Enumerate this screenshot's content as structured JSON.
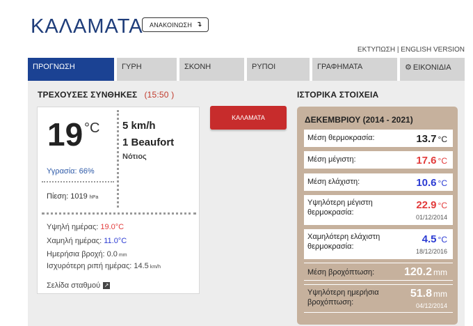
{
  "header": {
    "city": "ΚΑΛΑΜΑΤΑ",
    "announce_label": "ΑΝΑΚΟΙΝΩΣΗ",
    "announce_icon": "arrow-down-icon"
  },
  "links": {
    "print": "ΕΚΤΥΠΩΣΗ",
    "separator": "|",
    "english": "ENGLISH VERSION"
  },
  "tabs": [
    {
      "label": "ΠΡΟΓΝΩΣΗ",
      "active": true
    },
    {
      "label": "ΓΥΡΗ",
      "active": false
    },
    {
      "label": "ΣΚΟΝΗ",
      "active": false
    },
    {
      "label": "ΡΥΠΟΙ",
      "active": false
    },
    {
      "label": "ΓΡΑΦΗΜΑΤΑ",
      "active": false
    },
    {
      "label": "ΕΙΚΟΝΙΔΙΑ",
      "active": false,
      "icon": "gear-icon"
    }
  ],
  "current": {
    "heading": "ΤΡΕΧΟΥΣΕΣ ΣΥΝΘΗΚΕΣ",
    "time": "(15:50 )",
    "temperature": "19",
    "temp_unit": "°C",
    "wind_speed": "5 km/h",
    "wind_beaufort": "1 Beaufort",
    "wind_direction": "Νότιος",
    "humidity": "Υγρασία: 66%",
    "pressure_label": "Πίεση: 1019",
    "pressure_unit": "hPa",
    "high_label": "Υψηλή ημέρας: ",
    "high_value": "19.0°C",
    "low_label": "Χαμηλή ημέρας: ",
    "low_value": "11.0°C",
    "rain_label": "Ημερήσια βροχή: 0.0",
    "rain_unit": "mm",
    "gust_label": "Ισχυρότερη ριπή ημέρας: 14.5",
    "gust_unit": "km/h",
    "station_link": "Σελίδα σταθμού",
    "station_icon": "external-link-icon"
  },
  "city_button": "ΚΑΛΑΜΑΤΑ",
  "history": {
    "heading": "ΙΣΤΟΡΙΚΑ ΣΤΟΙΧΕΙΑ",
    "period": "ΔΕΚΕΜΒΡΙΟΥ (2014 - 2021)",
    "rows": [
      {
        "label": "Μέση θερμοκρασία:",
        "value": "13.7",
        "unit": "°C",
        "date": ""
      },
      {
        "label": "Μέση μέγιστη:",
        "value": "17.6",
        "unit": "°C",
        "date": ""
      },
      {
        "label": "Μέση ελάχιστη:",
        "value": "10.6",
        "unit": "°C",
        "date": ""
      },
      {
        "label": "Υψηλότερη μέγιστη θερμοκρασία:",
        "value": "22.9",
        "unit": "°C",
        "date": "01/12/2014"
      },
      {
        "label": "Χαμηλότερη ελάχιστη θερμοκρασία:",
        "value": "4.5",
        "unit": "°C",
        "date": "18/12/2016"
      },
      {
        "label": "Μέση βροχόπτωση:",
        "value": "120.2",
        "unit": "mm",
        "date": ""
      },
      {
        "label": "Υψηλότερη ημερήσια βροχόπτωση:",
        "value": "51.8",
        "unit": "mm",
        "date": "04/12/2014"
      }
    ]
  },
  "colors": {
    "brand_blue": "#1b4293",
    "high_red": "#e23b3b",
    "low_blue": "#2b3bd3",
    "history_bg": "#c6b19d",
    "button_red": "#c72c2c"
  }
}
